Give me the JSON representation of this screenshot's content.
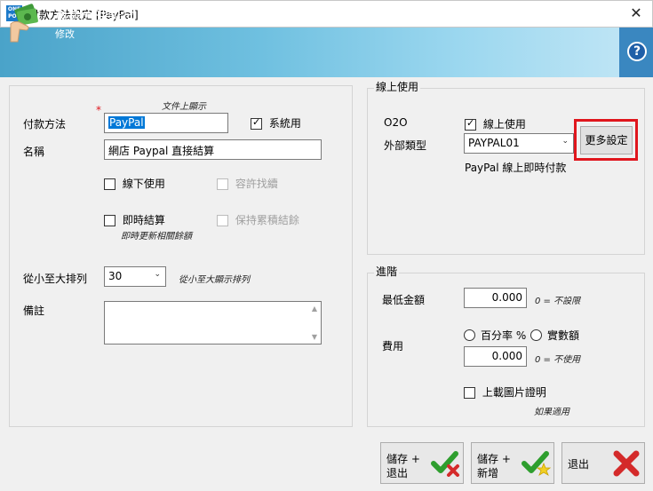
{
  "window": {
    "title": "付款方法設定 [PayPal]",
    "logo_text": "ONE POS",
    "close_label": "✕"
  },
  "header": {
    "title": "付款方法設定",
    "subtitle": "修改",
    "help_label": "?"
  },
  "form": {
    "doc_display_hint": "文件上顯示",
    "required_mark": "*",
    "payment_method_label": "付款方法",
    "payment_method_value": "PayPal",
    "system_use_label": "系統用",
    "name_label": "名稱",
    "name_value": "網店 Paypal 直接結算",
    "offline_use_label": "線下使用",
    "allow_change_label": "容許找續",
    "instant_settle_label": "即時結算",
    "instant_settle_hint": "即時更新相關餘額",
    "keep_balance_label": "保持累積結餘",
    "sort_label": "從小至大排列",
    "sort_value": "30",
    "sort_hint": "從小至大顯示排列",
    "remarks_label": "備註",
    "remarks_value": ""
  },
  "online": {
    "group_title": "線上使用",
    "o2o_label": "O2O",
    "online_use_label": "線上使用",
    "ext_type_label": "外部類型",
    "ext_type_value": "PAYPAL01",
    "more_settings_label": "更多設定",
    "ext_type_desc": "PayPal 線上即時付款"
  },
  "advanced": {
    "group_title": "進階",
    "min_amount_label": "最低金額",
    "min_amount_value": "0.000",
    "min_amount_hint": "0 = 不設限",
    "fee_label": "費用",
    "percent_label": "百分率 %",
    "actual_label": "實數額",
    "fee_value": "0.000",
    "fee_hint": "0 = 不使用",
    "upload_label": "上載圖片證明",
    "upload_hint": "如果適用"
  },
  "buttons": {
    "save_exit": "儲存 +\n退出",
    "save_new": "儲存 +\n新增",
    "exit": "退出"
  },
  "colors": {
    "highlight_red": "#e0161d",
    "selection_blue": "#0078d7",
    "help_blue": "#1f5fa8"
  }
}
